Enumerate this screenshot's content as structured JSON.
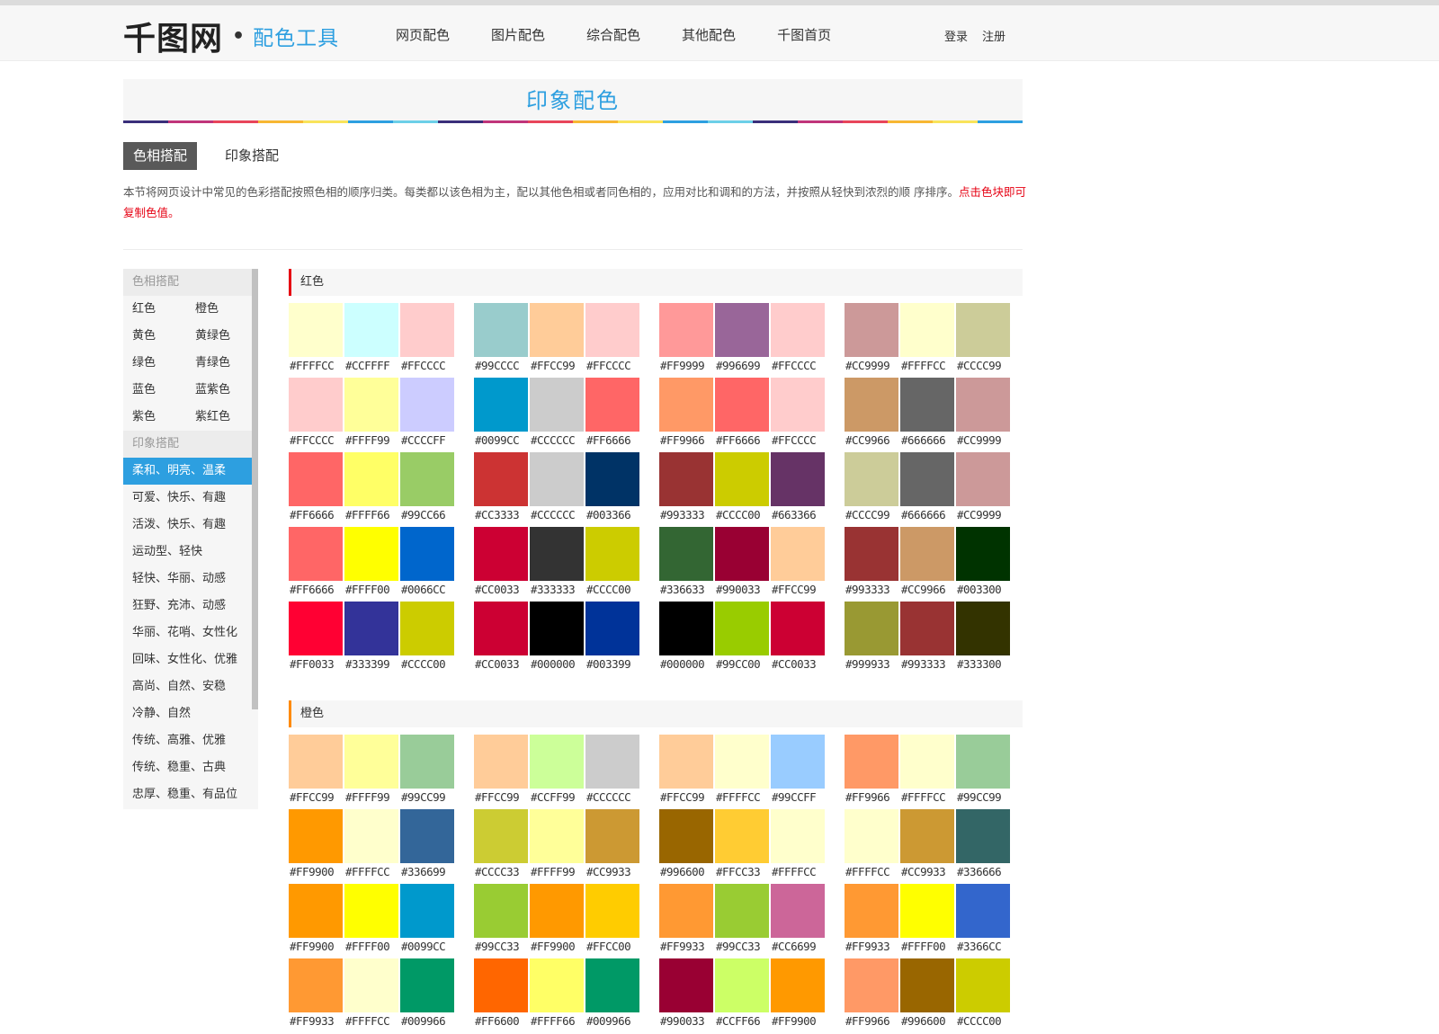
{
  "header": {
    "logo_main": "千图网",
    "logo_dot": "•",
    "logo_sub": "配色工具",
    "nav": [
      "网页配色",
      "图片配色",
      "综合配色",
      "其他配色",
      "千图首页"
    ],
    "auth": [
      "登录",
      "注册"
    ]
  },
  "banner": {
    "title": "印象配色",
    "stripe_colors": [
      "#3a2f7a",
      "#c0357a",
      "#e8455a",
      "#f7b733",
      "#f9e35a",
      "#2d9fe0",
      "#6ccfe8",
      "#3a2f7a",
      "#c0357a",
      "#e8455a",
      "#f7b733",
      "#f9e35a",
      "#2d9fe0",
      "#6ccfe8",
      "#3a2f7a",
      "#c0357a",
      "#e8455a",
      "#f7b733",
      "#f9e35a",
      "#2d9fe0"
    ]
  },
  "tabs": [
    "色相搭配",
    "印象搭配"
  ],
  "intro": {
    "text": "本节将网页设计中常见的色彩搭配按照色相的顺序归类。每类都以该色相为主，配以其他色相或者同色相的，应用对比和调和的方法，并按照从轻快到浓烈的顺 序排序。",
    "highlight": "点击色块即可复制色值。"
  },
  "sidebar": {
    "hue_header": "色相搭配",
    "hues": [
      "红色",
      "橙色",
      "黄色",
      "黄绿色",
      "绿色",
      "青绿色",
      "蓝色",
      "蓝紫色",
      "紫色",
      "紫红色"
    ],
    "impression_header": "印象搭配",
    "impressions": [
      "柔和、明亮、温柔",
      "可爱、快乐、有趣",
      "活泼、快乐、有趣",
      "运动型、轻快",
      "轻快、华丽、动感",
      "狂野、充沛、动感",
      "华丽、花哨、女性化",
      "回味、女性化、优雅",
      "高尚、自然、安稳",
      "冷静、自然",
      "传统、高雅、优雅",
      "传统、稳重、古典",
      "忠厚、稳重、有品位"
    ],
    "active_impression": 0
  },
  "sections": [
    {
      "title": "红色",
      "rows": [
        [
          [
            "#FFFFCC",
            "#CCFFFF",
            "#FFCCCC"
          ],
          [
            "#99CCCC",
            "#FFCC99",
            "#FFCCCC"
          ],
          [
            "#FF9999",
            "#996699",
            "#FFCCCC"
          ],
          [
            "#CC9999",
            "#FFFFCC",
            "#CCCC99"
          ]
        ],
        [
          [
            "#FFCCCC",
            "#FFFF99",
            "#CCCCFF"
          ],
          [
            "#0099CC",
            "#CCCCCC",
            "#FF6666"
          ],
          [
            "#FF9966",
            "#FF6666",
            "#FFCCCC"
          ],
          [
            "#CC9966",
            "#666666",
            "#CC9999"
          ]
        ],
        [
          [
            "#FF6666",
            "#FFFF66",
            "#99CC66"
          ],
          [
            "#CC3333",
            "#CCCCCC",
            "#003366"
          ],
          [
            "#993333",
            "#CCCC00",
            "#663366"
          ],
          [
            "#CCCC99",
            "#666666",
            "#CC9999"
          ]
        ],
        [
          [
            "#FF6666",
            "#FFFF00",
            "#0066CC"
          ],
          [
            "#CC0033",
            "#333333",
            "#CCCC00"
          ],
          [
            "#336633",
            "#990033",
            "#FFCC99"
          ],
          [
            "#993333",
            "#CC9966",
            "#003300"
          ]
        ],
        [
          [
            "#FF0033",
            "#333399",
            "#CCCC00"
          ],
          [
            "#CC0033",
            "#000000",
            "#003399"
          ],
          [
            "#000000",
            "#99CC00",
            "#CC0033"
          ],
          [
            "#999933",
            "#993333",
            "#333300"
          ]
        ]
      ]
    },
    {
      "title": "橙色",
      "rows": [
        [
          [
            "#FFCC99",
            "#FFFF99",
            "#99CC99"
          ],
          [
            "#FFCC99",
            "#CCFF99",
            "#CCCCCC"
          ],
          [
            "#FFCC99",
            "#FFFFCC",
            "#99CCFF"
          ],
          [
            "#FF9966",
            "#FFFFCC",
            "#99CC99"
          ]
        ],
        [
          [
            "#FF9900",
            "#FFFFCC",
            "#336699"
          ],
          [
            "#CCCC33",
            "#FFFF99",
            "#CC9933"
          ],
          [
            "#996600",
            "#FFCC33",
            "#FFFFCC"
          ],
          [
            "#FFFFCC",
            "#CC9933",
            "#336666"
          ]
        ],
        [
          [
            "#FF9900",
            "#FFFF00",
            "#0099CC"
          ],
          [
            "#99CC33",
            "#FF9900",
            "#FFCC00"
          ],
          [
            "#FF9933",
            "#99CC33",
            "#CC6699"
          ],
          [
            "#FF9933",
            "#FFFF00",
            "#3366CC"
          ]
        ],
        [
          [
            "#FF9933",
            "#FFFFCC",
            "#009966"
          ],
          [
            "#FF6600",
            "#FFFF66",
            "#009966"
          ],
          [
            "#990033",
            "#CCFF66",
            "#FF9900"
          ],
          [
            "#FF9966",
            "#996600",
            "#CCCC00"
          ]
        ]
      ]
    }
  ]
}
